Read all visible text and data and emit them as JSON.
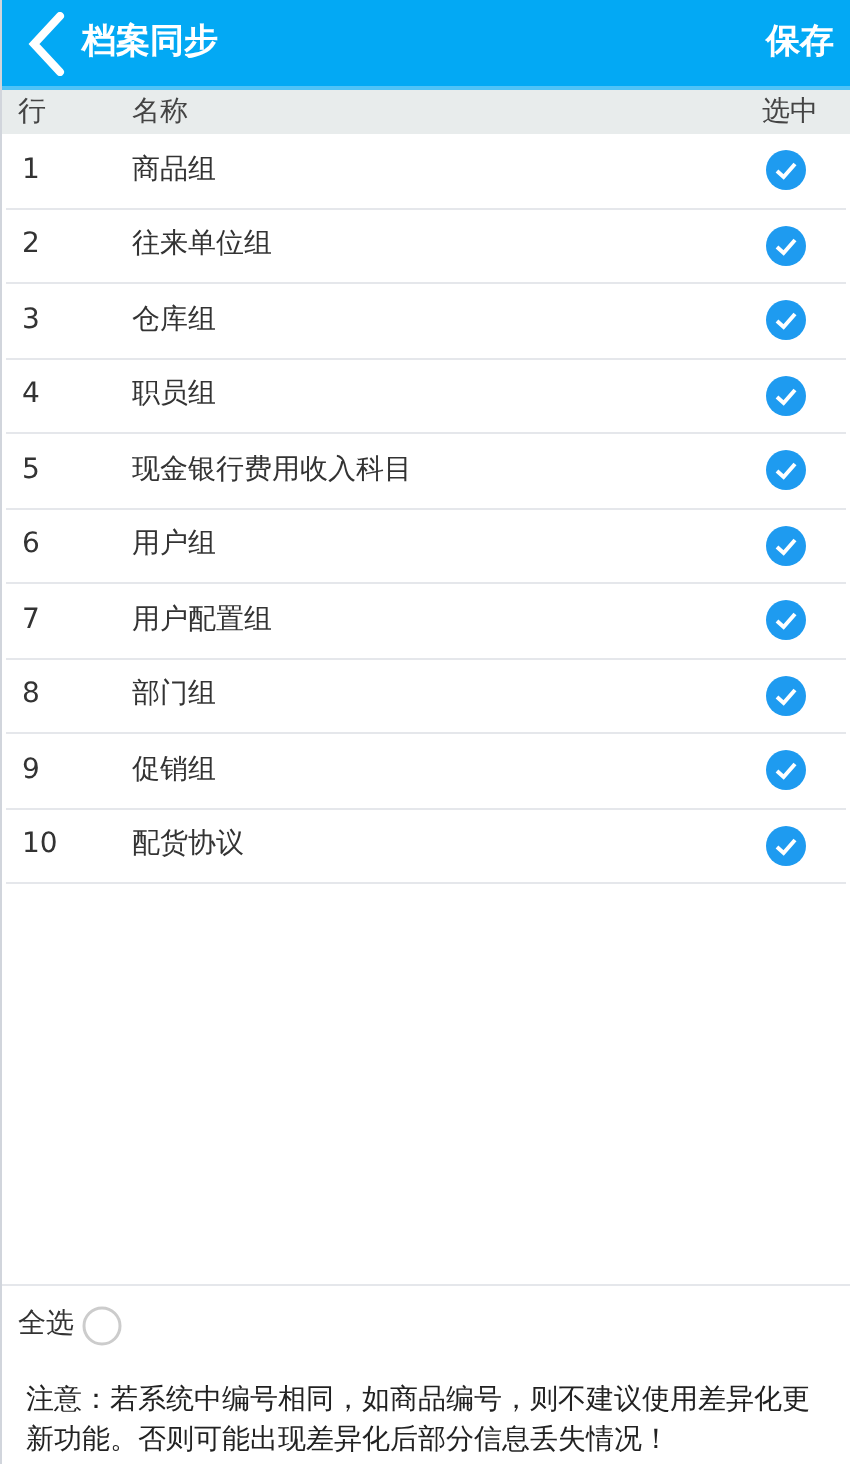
{
  "header": {
    "title": "档案同步",
    "action": "保存"
  },
  "table": {
    "columns": [
      "行",
      "名称",
      "选中"
    ],
    "rows": [
      {
        "index": "1",
        "name": "商品组",
        "checked": true
      },
      {
        "index": "2",
        "name": "往来单位组",
        "checked": true
      },
      {
        "index": "3",
        "name": "仓库组",
        "checked": true
      },
      {
        "index": "4",
        "name": "职员组",
        "checked": true
      },
      {
        "index": "5",
        "name": "现金银行费用收入科目",
        "checked": true
      },
      {
        "index": "6",
        "name": "用户组",
        "checked": true
      },
      {
        "index": "7",
        "name": "用户配置组",
        "checked": true
      },
      {
        "index": "8",
        "name": "部门组",
        "checked": true
      },
      {
        "index": "9",
        "name": "促销组",
        "checked": true
      },
      {
        "index": "10",
        "name": "配货协议",
        "checked": true
      }
    ]
  },
  "select_all": {
    "label": "全选",
    "checked": false
  },
  "note": "注意：若系统中编号相同，如商品编号，则不建议使用差异化更新功能。否则可能出现差异化后部分信息丢失情况！"
}
